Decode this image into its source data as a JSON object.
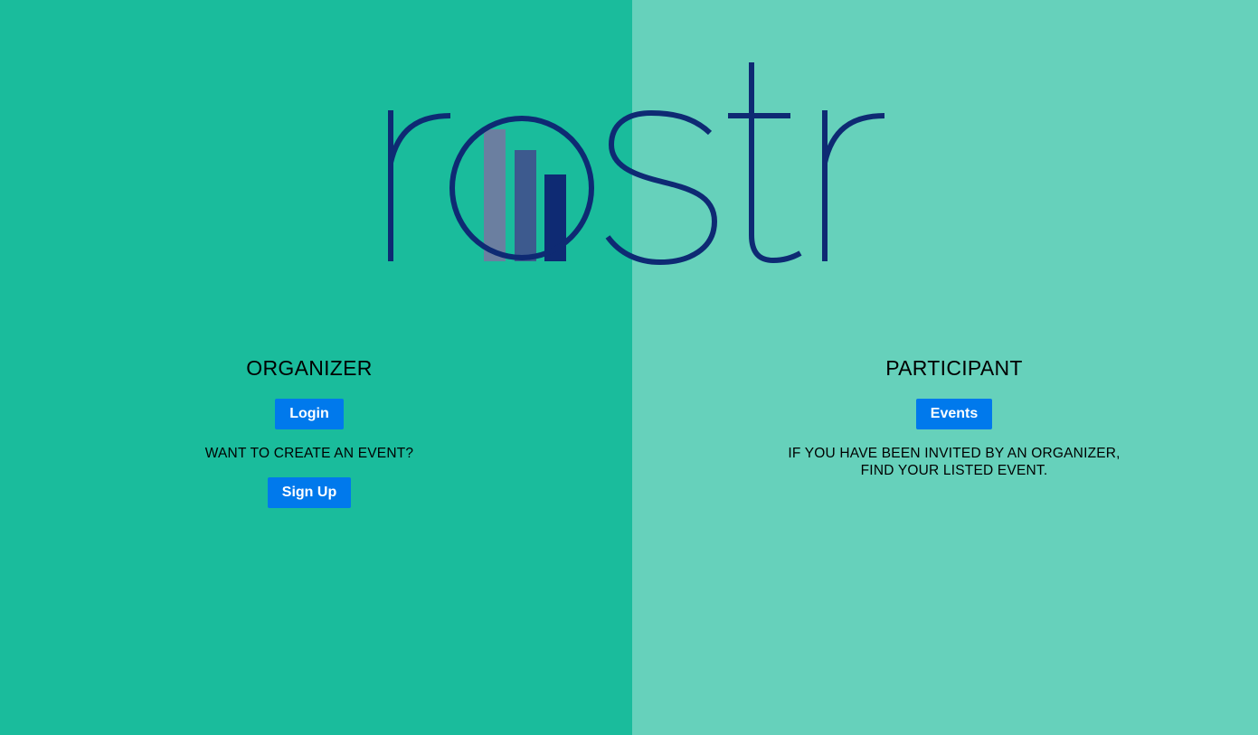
{
  "logo": {
    "text": "rostr",
    "icon": "bar-chart-icon",
    "colors": {
      "stroke": "#0e2a73",
      "bar1": "#6b7fa0",
      "bar2": "#3d5a8e",
      "bar3": "#0e2a73"
    }
  },
  "colors": {
    "left_panel": "#1abc9c",
    "right_panel": "#66d1bb",
    "button": "#0079ec"
  },
  "organizer": {
    "heading": "ORGANIZER",
    "login_label": "Login",
    "create_prompt": "WANT TO CREATE AN EVENT?",
    "signup_label": "Sign Up"
  },
  "participant": {
    "heading": "PARTICIPANT",
    "events_label": "Events",
    "note_line1": "IF YOU HAVE BEEN INVITED BY AN ORGANIZER,",
    "note_line2": "FIND YOUR LISTED EVENT."
  }
}
